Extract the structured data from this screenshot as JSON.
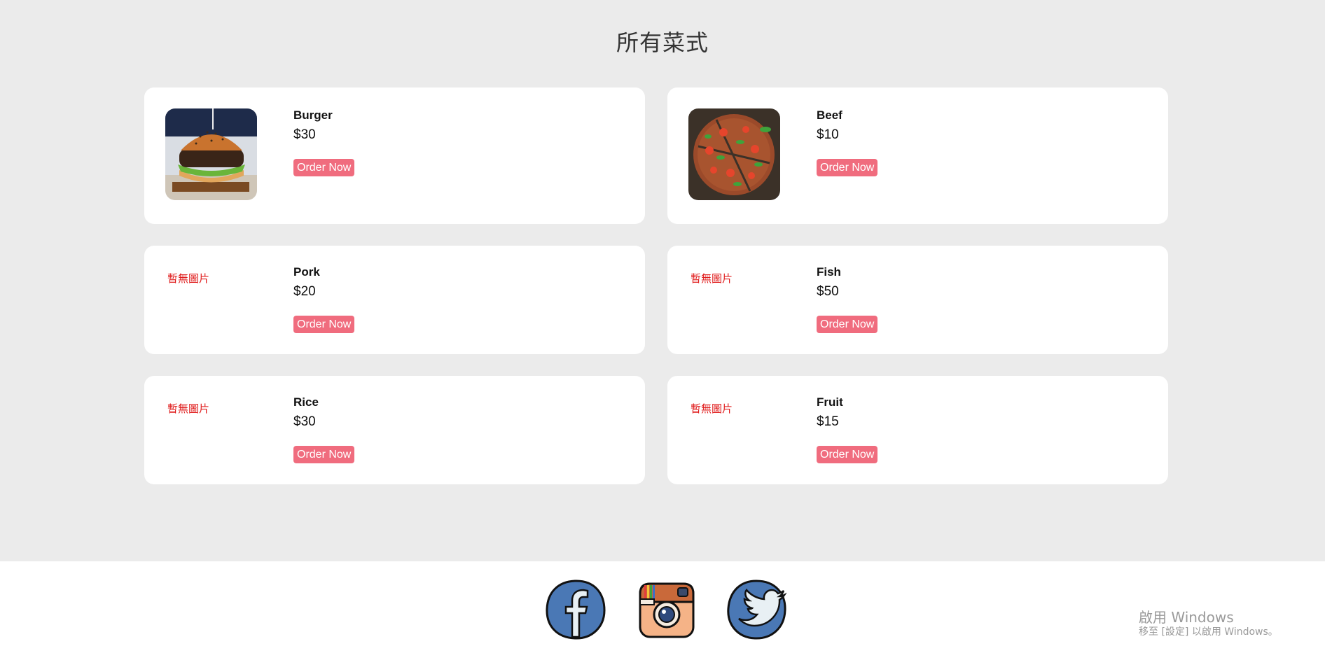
{
  "page": {
    "title": "所有菜式"
  },
  "dishes": [
    {
      "name": "Burger",
      "price": "$30",
      "order_label": "Order Now",
      "image": "burger-photo"
    },
    {
      "name": "Beef",
      "price": "$10",
      "order_label": "Order Now",
      "image": "pizza-photo"
    },
    {
      "name": "Pork",
      "price": "$20",
      "order_label": "Order Now",
      "no_image_text": "暫無圖片"
    },
    {
      "name": "Fish",
      "price": "$50",
      "order_label": "Order Now",
      "no_image_text": "暫無圖片"
    },
    {
      "name": "Rice",
      "price": "$30",
      "order_label": "Order Now",
      "no_image_text": "暫無圖片"
    },
    {
      "name": "Fruit",
      "price": "$15",
      "order_label": "Order Now",
      "no_image_text": "暫無圖片"
    }
  ],
  "footer": {
    "social_icons": [
      "facebook-icon",
      "instagram-icon",
      "twitter-icon"
    ]
  },
  "watermark": {
    "title": "啟用 Windows",
    "subtitle": "移至 [設定] 以啟用 Windows。"
  },
  "colors": {
    "background": "#ebebeb",
    "card": "#ffffff",
    "button": "#f06c7e",
    "no_image_text": "#e01c1c",
    "social_blue": "#4a78b5"
  }
}
